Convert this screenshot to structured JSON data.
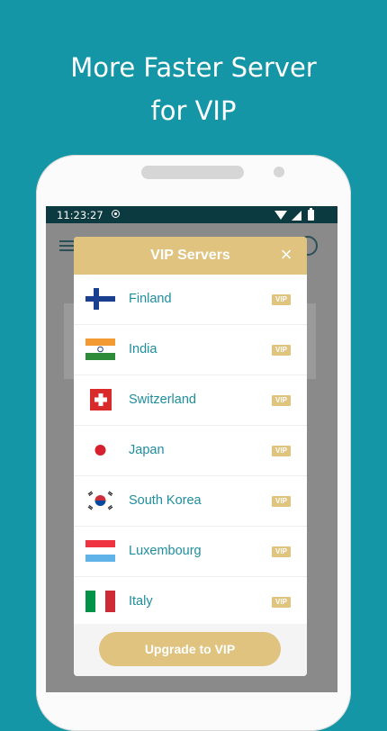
{
  "headline": {
    "line1": "More Faster Server",
    "line2": "for VIP"
  },
  "status_bar": {
    "time": "11:23:27",
    "icons": [
      "record-icon",
      "wifi-icon",
      "signal-icon",
      "battery-icon"
    ]
  },
  "dialog": {
    "title": "VIP Servers",
    "close_label": "×",
    "servers": [
      {
        "country": "Finland",
        "badge": "VIP",
        "flag": "finland-flag-icon"
      },
      {
        "country": "India",
        "badge": "VIP",
        "flag": "india-flag-icon"
      },
      {
        "country": "Switzerland",
        "badge": "VIP",
        "flag": "switzerland-flag-icon"
      },
      {
        "country": "Japan",
        "badge": "VIP",
        "flag": "japan-flag-icon"
      },
      {
        "country": "South Korea",
        "badge": "VIP",
        "flag": "south-korea-flag-icon"
      },
      {
        "country": "Luxembourg",
        "badge": "VIP",
        "flag": "luxembourg-flag-icon"
      },
      {
        "country": "Italy",
        "badge": "VIP",
        "flag": "italy-flag-icon"
      }
    ],
    "upgrade_label": "Upgrade to VIP"
  },
  "colors": {
    "background": "#1596a6",
    "accent_gold": "#dfc37f",
    "country_text": "#1e8e9e",
    "status_bar": "#0b3a40"
  }
}
